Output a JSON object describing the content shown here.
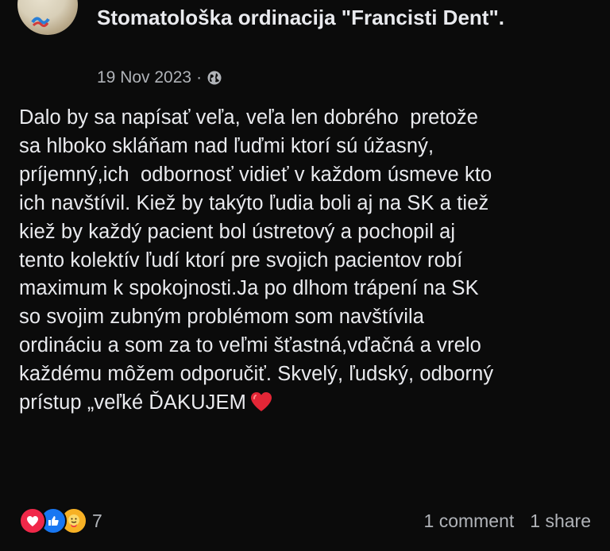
{
  "post": {
    "author": "Stomatološka ordinacija \"Francisti Dent\".",
    "date": "19 Nov 2023",
    "separator": "·",
    "audience_icon": "globe-icon",
    "text": "Dalo by sa napísať veľa, veľa len dobrého  pretože\nsa hlboko skláňam nad ľuďmi ktorí sú úžasný,\npríjemný,ich  odbornosť vidieť v každom úsmeve kto\nich navštívil. Kiež by takýto ľudia boli aj na SK a tiež\nkiež by každý pacient bol ústretový a pochopil aj\ntento kolektív ľudí ktorí pre svojich pacientov robí\nmaximum k spokojnosti.Ja po dlhom trápení na SK\nso svojim zubným problémom som navštívila\nordináciu a som za to veľmi šťastná,vďačná a vrelo\nkaždému môžem odporučiť. Skvelý, ľudský, odborný\nprístup „veľké ĎAKUJEM"
  },
  "reactions": {
    "icons": [
      "love-reaction-icon",
      "like-reaction-icon",
      "care-reaction-icon"
    ],
    "count": "7"
  },
  "stats": {
    "comments": "1 comment",
    "shares": "1 share"
  },
  "colors": {
    "background": "#0b0b0b",
    "text": "#e9eaee",
    "secondary_text": "#b0b3b8",
    "love": "#f02849",
    "like": "#1877f2",
    "care": "#f7b125"
  }
}
